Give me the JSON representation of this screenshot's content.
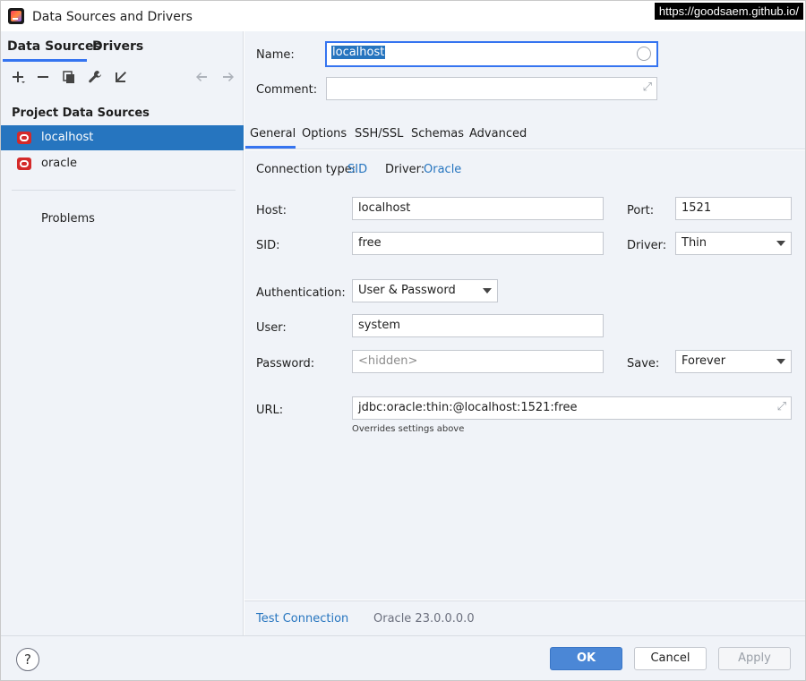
{
  "window": {
    "title": "Data Sources and Drivers",
    "watermark": "https://goodsaem.github.io/"
  },
  "left": {
    "tabs": [
      "Data Sources",
      "Drivers"
    ],
    "toolbar": [
      "add-icon",
      "remove-icon",
      "copy-icon",
      "wrench-icon",
      "import-icon",
      "back-arrow-icon",
      "forward-arrow-icon"
    ],
    "section_title": "Project Data Sources",
    "items": [
      {
        "label": "localhost",
        "selected": true
      },
      {
        "label": "oracle",
        "selected": false
      }
    ],
    "problems_label": "Problems"
  },
  "header": {
    "name_label": "Name:",
    "name_value": "localhost",
    "comment_label": "Comment:",
    "comment_value": ""
  },
  "tabs": [
    "General",
    "Options",
    "SSH/SSL",
    "Schemas",
    "Advanced"
  ],
  "general": {
    "connection_type_label": "Connection type:",
    "connection_type_value": "SID",
    "driver_label": "Driver:",
    "driver_value": "Oracle",
    "host_label": "Host:",
    "host_value": "localhost",
    "port_label": "Port:",
    "port_value": "1521",
    "sid_label": "SID:",
    "sid_value": "free",
    "driver_select_label": "Driver:",
    "driver_select_value": "Thin",
    "auth_label": "Authentication:",
    "auth_value": "User & Password",
    "user_label": "User:",
    "user_value": "system",
    "password_label": "Password:",
    "password_placeholder": "<hidden>",
    "save_label": "Save:",
    "save_value": "Forever",
    "url_label": "URL:",
    "url_value": "jdbc:oracle:thin:@localhost:1521:free",
    "url_hint": "Overrides settings above"
  },
  "footer": {
    "test_connection": "Test Connection",
    "version": "Oracle 23.0.0.0.0"
  },
  "buttons": {
    "help": "?",
    "ok": "OK",
    "cancel": "Cancel",
    "apply": "Apply"
  },
  "colors": {
    "accent": "#3574f0",
    "selection": "#2675bf",
    "panel_bg": "#f0f3f8",
    "link": "#2675bf"
  }
}
